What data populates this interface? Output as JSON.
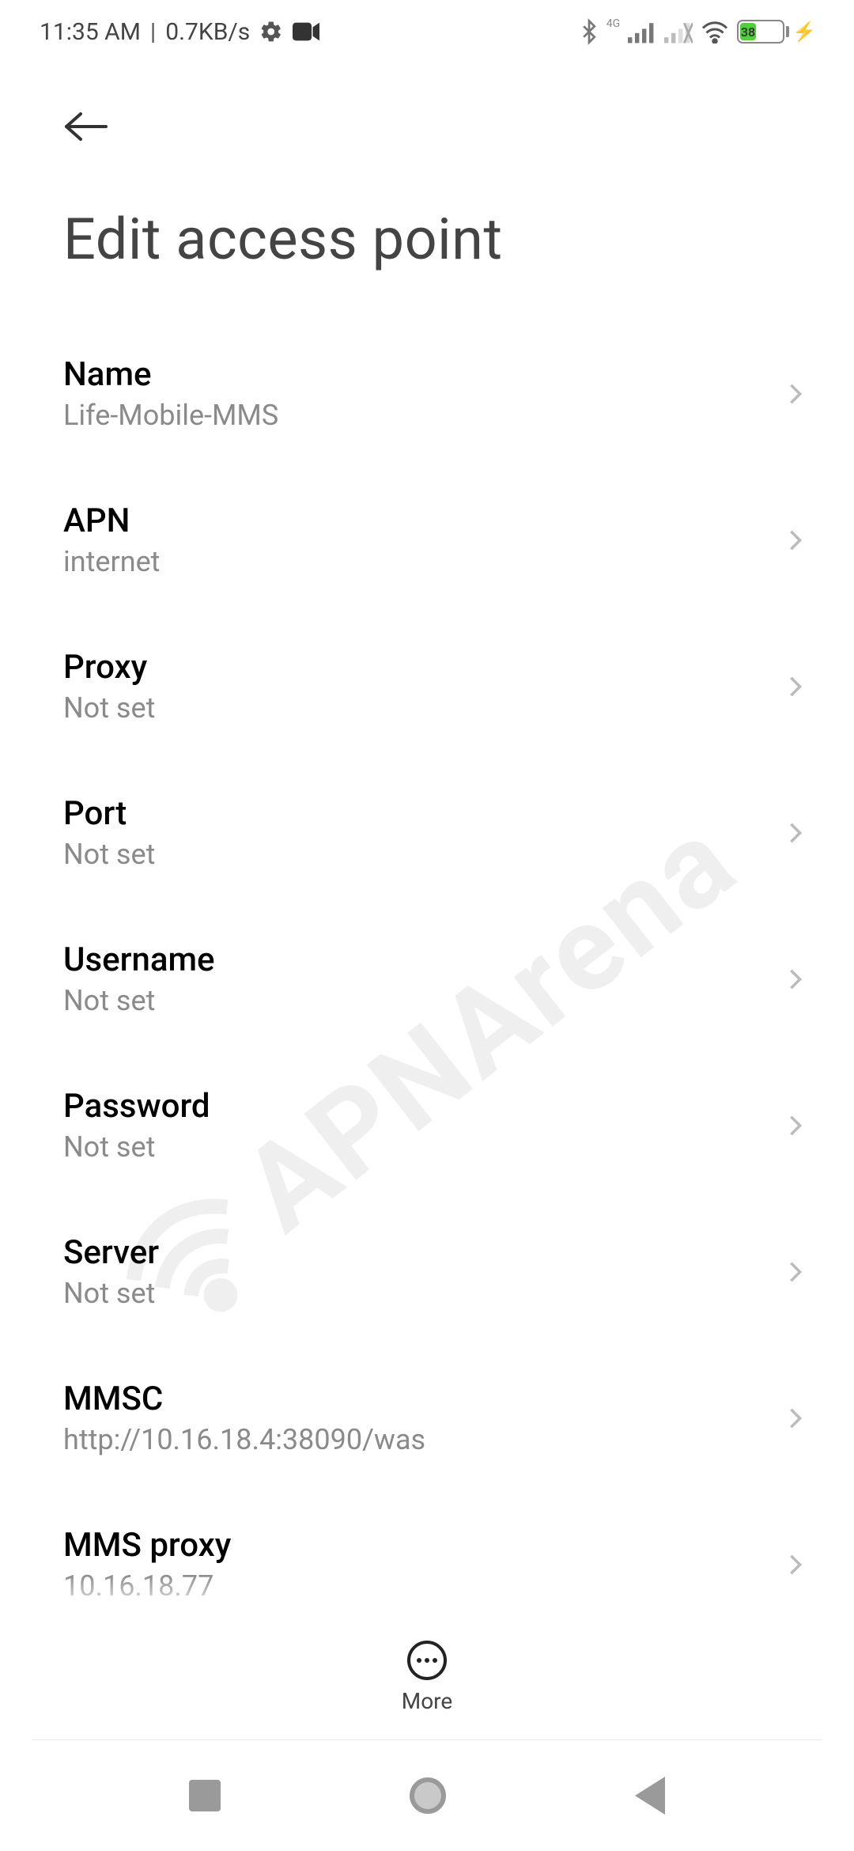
{
  "status": {
    "time": "11:35 AM",
    "rate": "0.7KB/s",
    "fourg_label": "4G",
    "battery_percent": "38"
  },
  "header": {
    "title": "Edit access point"
  },
  "rows": {
    "name": {
      "label": "Name",
      "value": "Life-Mobile-MMS"
    },
    "apn": {
      "label": "APN",
      "value": "internet"
    },
    "proxy": {
      "label": "Proxy",
      "value": "Not set"
    },
    "port": {
      "label": "Port",
      "value": "Not set"
    },
    "username": {
      "label": "Username",
      "value": "Not set"
    },
    "password": {
      "label": "Password",
      "value": "Not set"
    },
    "server": {
      "label": "Server",
      "value": "Not set"
    },
    "mmsc": {
      "label": "MMSC",
      "value": "http://10.16.18.4:38090/was"
    },
    "mmsproxy": {
      "label": "MMS proxy",
      "value": "10.16.18.77"
    }
  },
  "more": {
    "label": "More"
  },
  "watermark": {
    "text": "APNArena"
  }
}
